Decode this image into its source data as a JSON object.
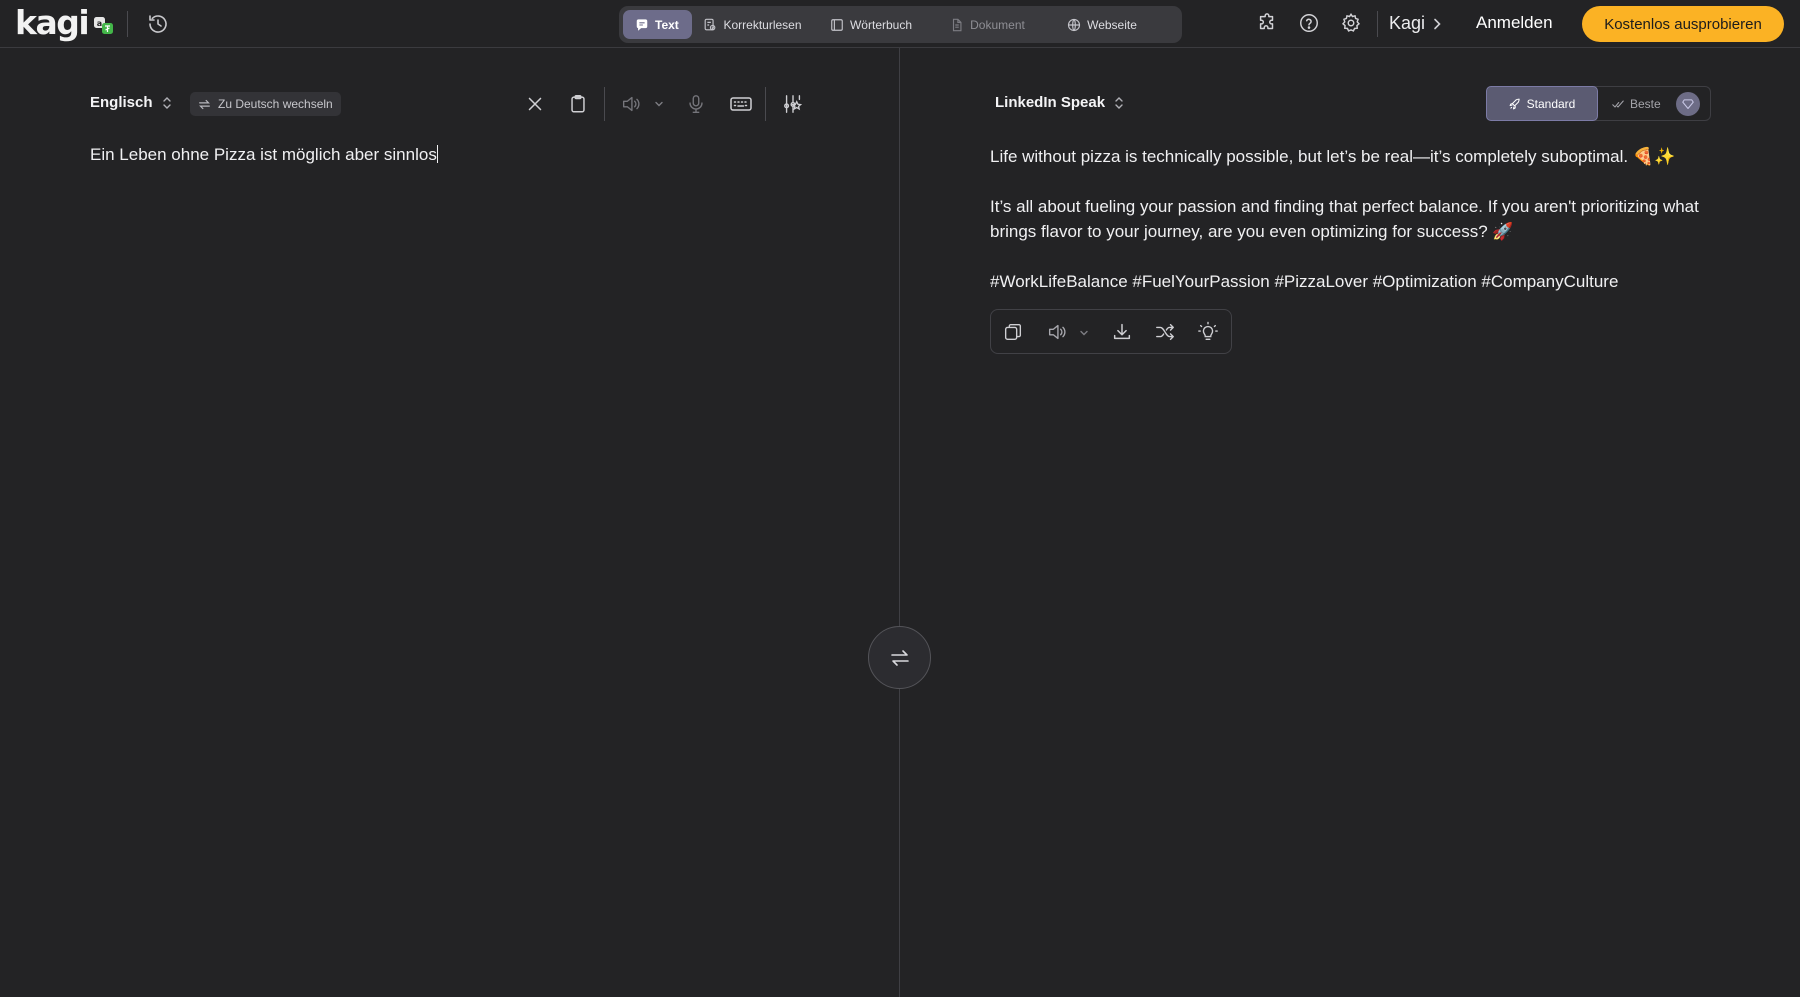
{
  "brand": {
    "logo_text": "kagi"
  },
  "modes": [
    {
      "label": "Text",
      "icon": "chat-bubble-icon",
      "active": true
    },
    {
      "label": "Korrekturlesen",
      "icon": "proofread-icon"
    },
    {
      "label": "Wörterbuch",
      "icon": "book-icon"
    },
    {
      "label": "Dokument",
      "icon": "document-icon",
      "disabled": true
    },
    {
      "label": "Webseite",
      "icon": "globe-icon"
    }
  ],
  "header": {
    "kagi_link": "Kagi",
    "signin": "Anmelden",
    "cta": "Kostenlos ausprobieren",
    "cta_color": "#fbb224"
  },
  "source": {
    "language": "Englisch",
    "switch_label": "Zu Deutsch wechseln",
    "text": "Ein Leben ohne Pizza ist möglich aber sinnlos"
  },
  "target": {
    "language": "LinkedIn Speak",
    "quality_standard": "Standard",
    "quality_best": "Beste",
    "paragraphs": [
      "Life without pizza is technically possible, but let’s be real—it’s completely suboptimal. 🍕✨",
      "It’s all about fueling your passion and finding that perfect balance. If you aren't prioritizing what brings flavor to your journey, are you even optimizing for success? 🚀",
      "#WorkLifeBalance #FuelYourPassion #PizzaLover #Optimization #CompanyCulture"
    ]
  },
  "colors": {
    "background": "#232325",
    "active_tab": "#6d6c8a",
    "accent": "#fbb224"
  }
}
